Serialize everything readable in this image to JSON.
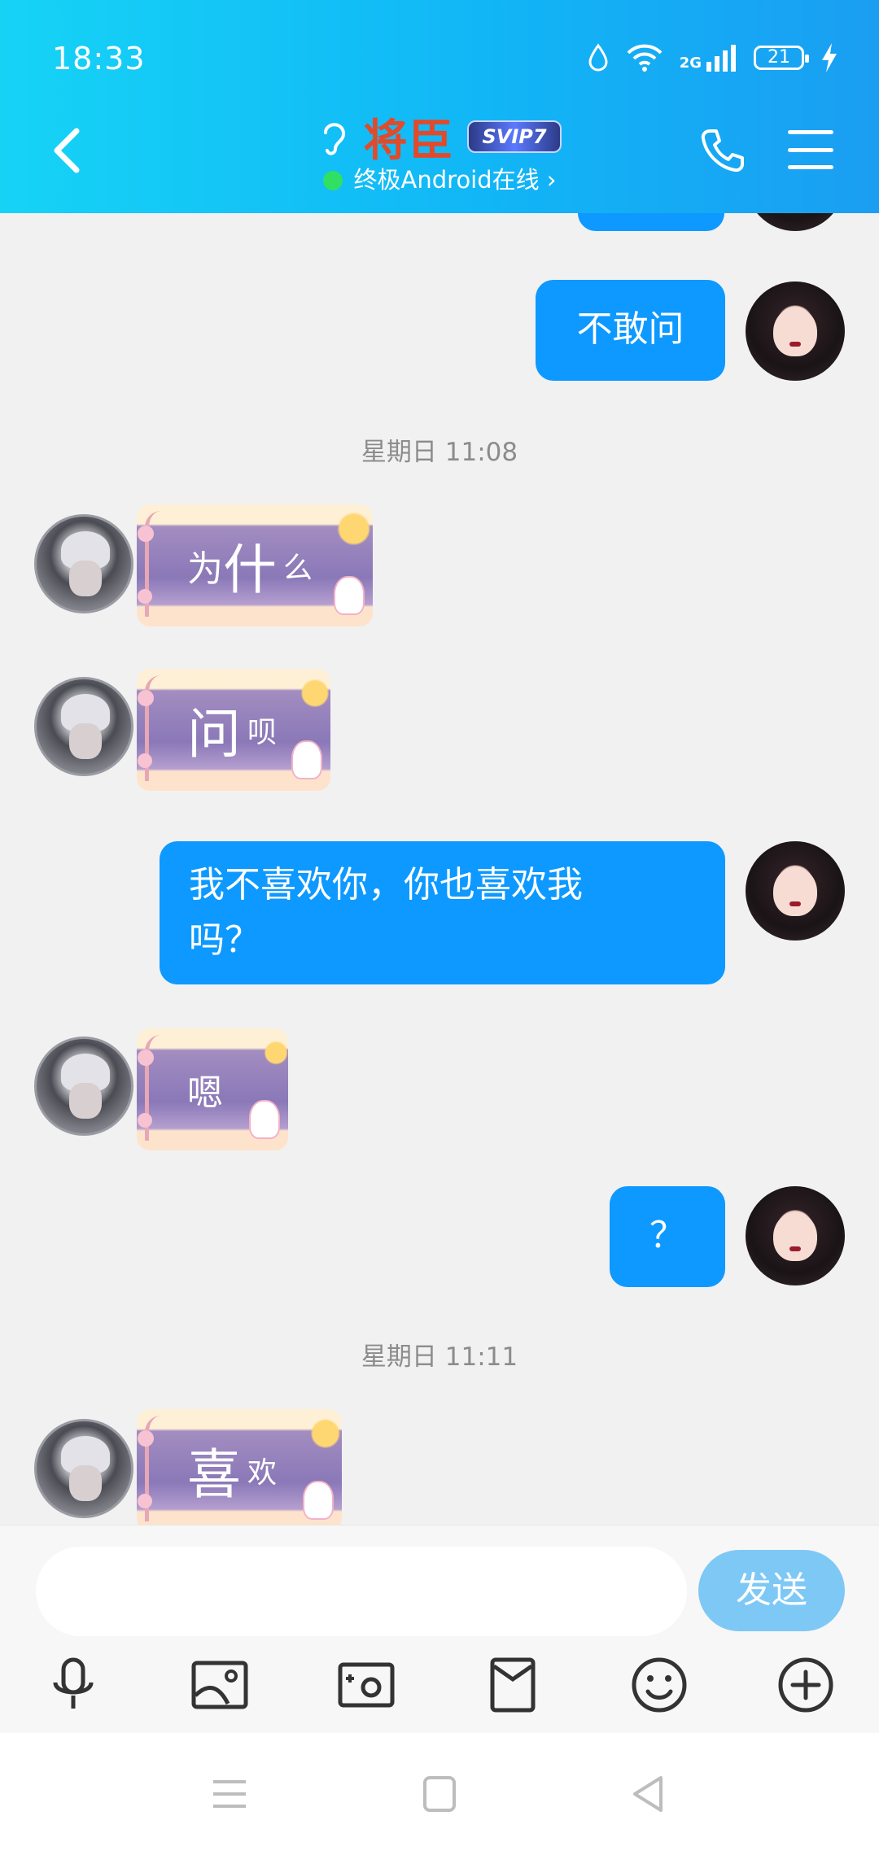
{
  "status_bar": {
    "time": "18:33",
    "network": "2G",
    "battery": "21"
  },
  "header": {
    "contact_name": "将臣",
    "vip_badge": "SVIP7",
    "status_text": "终极Android在线 ›"
  },
  "messages": {
    "m1_text": "不敢问",
    "time1": "星期日 11:08",
    "r1_big": "为",
    "r1_big2": "什",
    "r1_small": "么",
    "r2_big": "问",
    "r2_small": "呗",
    "m2_line1": "我不喜欢你，你也喜欢我",
    "m2_line2": "吗？",
    "r3_text": "嗯",
    "m3_text": "？",
    "time2": "星期日 11:11",
    "r4_big": "喜",
    "r4_small": "欢"
  },
  "input": {
    "placeholder": "",
    "send_label": "发送"
  },
  "icons": {
    "toolbar": [
      "microphone-icon",
      "picture-icon",
      "camera-icon",
      "red-packet-icon",
      "emoji-icon",
      "plus-icon"
    ],
    "nav": [
      "menu-icon",
      "home-square-icon",
      "back-triangle-icon"
    ]
  }
}
